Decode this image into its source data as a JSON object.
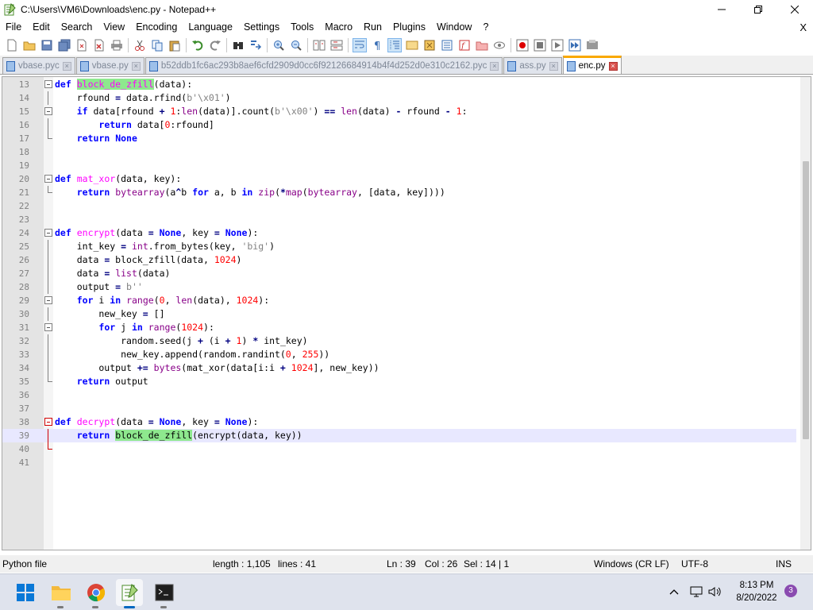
{
  "window": {
    "title": "C:\\Users\\VM6\\Downloads\\enc.py - Notepad++"
  },
  "menu": [
    "File",
    "Edit",
    "Search",
    "View",
    "Encoding",
    "Language",
    "Settings",
    "Tools",
    "Macro",
    "Run",
    "Plugins",
    "Window",
    "?"
  ],
  "menu_close": "X",
  "tabs": [
    {
      "label": "vbase.pyc",
      "active": false
    },
    {
      "label": "vbase.py",
      "active": false
    },
    {
      "label": "b52ddb1fc6ac293b8aef6cfd2909d0cc6f92126684914b4f4d252d0e310c2162.pyc",
      "active": false
    },
    {
      "label": "ass.py",
      "active": false
    },
    {
      "label": "enc.py",
      "active": true
    }
  ],
  "editor": {
    "lines": [
      {
        "n": "13",
        "text": "def block_de_zfill(data):"
      },
      {
        "n": "14",
        "text": "    rfound = data.rfind(b'\\x01')"
      },
      {
        "n": "15",
        "text": "    if data[rfound + 1:len(data)].count(b'\\x00') == len(data) - rfound - 1:"
      },
      {
        "n": "16",
        "text": "        return data[0:rfound]"
      },
      {
        "n": "17",
        "text": "    return None"
      },
      {
        "n": "18",
        "text": ""
      },
      {
        "n": "19",
        "text": ""
      },
      {
        "n": "20",
        "text": "def mat_xor(data, key):"
      },
      {
        "n": "21",
        "text": "    return bytearray(a^b for a, b in zip(*map(bytearray, [data, key])))"
      },
      {
        "n": "22",
        "text": ""
      },
      {
        "n": "23",
        "text": ""
      },
      {
        "n": "24",
        "text": "def encrypt(data = None, key = None):"
      },
      {
        "n": "25",
        "text": "    int_key = int.from_bytes(key, 'big')"
      },
      {
        "n": "26",
        "text": "    data = block_zfill(data, 1024)"
      },
      {
        "n": "27",
        "text": "    data = list(data)"
      },
      {
        "n": "28",
        "text": "    output = b''"
      },
      {
        "n": "29",
        "text": "    for i in range(0, len(data), 1024):"
      },
      {
        "n": "30",
        "text": "        new_key = []"
      },
      {
        "n": "31",
        "text": "        for j in range(1024):"
      },
      {
        "n": "32",
        "text": "            random.seed(j + (i + 1) * int_key)"
      },
      {
        "n": "33",
        "text": "            new_key.append(random.randint(0, 255))"
      },
      {
        "n": "34",
        "text": "        output += bytes(mat_xor(data[i:i + 1024], new_key))"
      },
      {
        "n": "35",
        "text": "    return output"
      },
      {
        "n": "36",
        "text": ""
      },
      {
        "n": "37",
        "text": ""
      },
      {
        "n": "38",
        "text": "def decrypt(data = None, key = None):"
      },
      {
        "n": "39",
        "text": "    return block_de_zfill(encrypt(data, key))"
      },
      {
        "n": "40",
        "text": ""
      },
      {
        "n": "41",
        "text": ""
      }
    ],
    "current_line": "39",
    "highlight_word": "block_de_zfill"
  },
  "status": {
    "filetype": "Python file",
    "length": "length : 1,105",
    "lines": "lines : 41",
    "ln": "Ln : 39",
    "col": "Col : 26",
    "sel": "Sel : 14 | 1",
    "eol": "Windows (CR LF)",
    "encoding": "UTF-8",
    "mode": "INS"
  },
  "taskbar": {
    "apps": [
      "start-icon",
      "file-explorer-icon",
      "chrome-icon",
      "notepadpp-icon",
      "terminal-icon"
    ],
    "time": "8:13 PM",
    "date": "8/20/2022",
    "notifications": "3"
  },
  "colors": {
    "keyword": "#0000ff",
    "function_name": "#ff00ff",
    "builtin": "#880088",
    "string": "#808080",
    "number": "#ff0000",
    "highlight": "#8ee88e",
    "current_line": "#e8e8ff",
    "active_tab_accent": "#f9a800"
  }
}
